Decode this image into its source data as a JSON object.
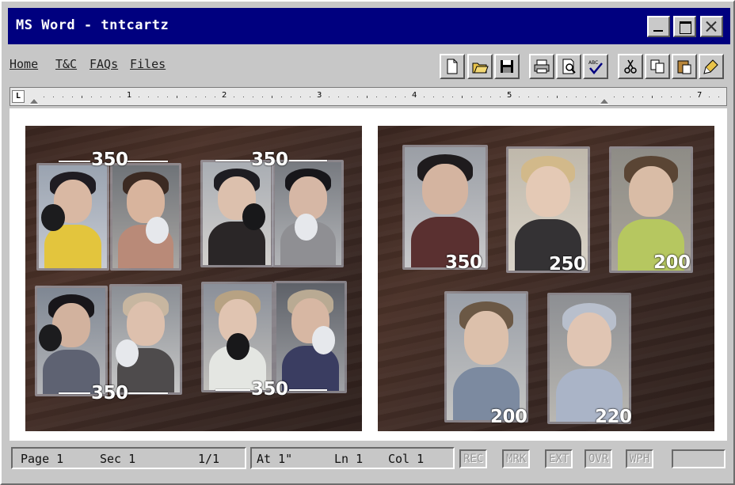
{
  "window": {
    "title": "MS Word - tntcartz"
  },
  "menu": [
    {
      "label": "Home"
    },
    {
      "label": "T&C"
    },
    {
      "label": "FAQs"
    },
    {
      "label": "Files"
    }
  ],
  "toolbar": {
    "buttons": [
      "new-document",
      "open-folder",
      "save",
      "print",
      "print-preview",
      "spell-check",
      "cut",
      "copy",
      "paste",
      "format-painter"
    ]
  },
  "ruler": {
    "numbers": [
      "1",
      "2",
      "3",
      "4",
      "5",
      "7"
    ]
  },
  "document": {
    "left_panel": {
      "prices": [
        "350",
        "350",
        "350",
        "350"
      ]
    },
    "right_panel": {
      "prices": [
        "350",
        "250",
        "200",
        "200",
        "220"
      ]
    }
  },
  "status": {
    "page": "Page 1",
    "sec": "Sec 1",
    "pages": "1/1",
    "at": "At 1\"",
    "ln": "Ln 1",
    "col": "Col 1",
    "flags": [
      "REC",
      "MRK",
      "EXT",
      "OVR",
      "WPH"
    ]
  }
}
